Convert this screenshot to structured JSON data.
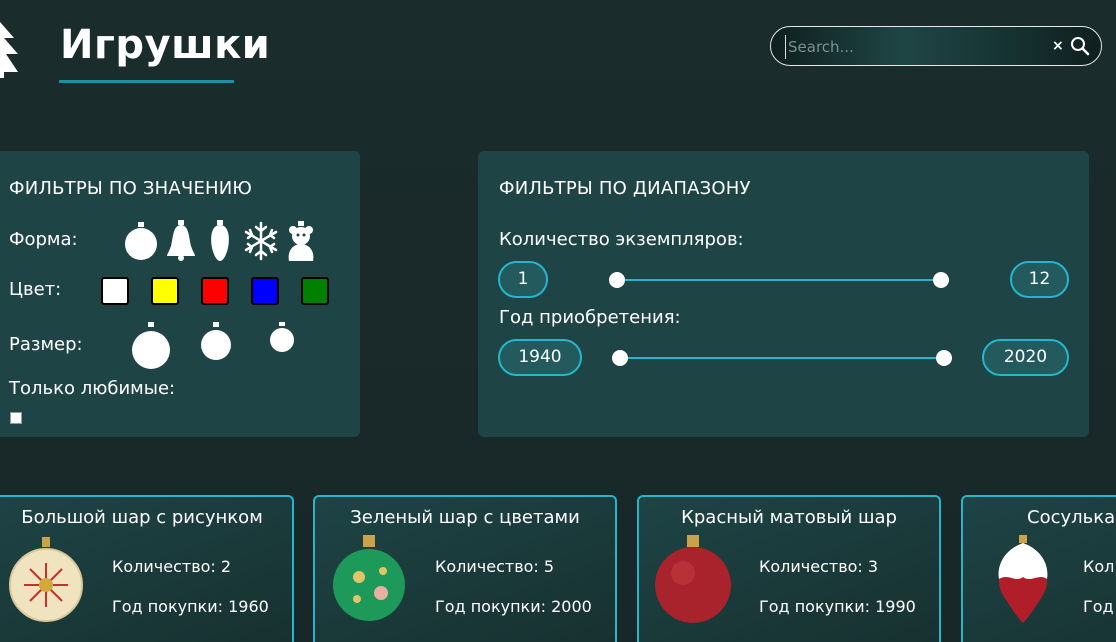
{
  "header": {
    "title": "Игрушки",
    "search_placeholder": "Search...",
    "clear_symbol": "×"
  },
  "filters_value": {
    "heading": "ФИЛЬТРЫ ПО ЗНАЧЕНИЮ",
    "shape_label": "Форма:",
    "shapes": [
      "ball-icon",
      "bell-icon",
      "cone-icon",
      "snowflake-icon",
      "figurine-icon"
    ],
    "color_label": "Цвет:",
    "colors": [
      "#ffffff",
      "#ffff00",
      "#ff0000",
      "#0000ff",
      "#008000"
    ],
    "size_label": "Размер:",
    "sizes": [
      "large",
      "medium",
      "small"
    ],
    "favorite_label": "Только любимые:"
  },
  "filters_range": {
    "heading": "ФИЛЬТРЫ ПО ДИАПАЗОНУ",
    "count_label": "Количество экземпляров:",
    "count_min": "1",
    "count_max": "12",
    "year_label": "Год приобретения:",
    "year_min": "1940",
    "year_max": "2020"
  },
  "cards": [
    {
      "title": "Большой шар с рисунком",
      "count": "Количество: 2",
      "year": "Год покупки: 1960",
      "image": "cream-ball-icon"
    },
    {
      "title": "Зеленый шар с цветами",
      "count": "Количество: 5",
      "year": "Год покупки: 2000",
      "image": "green-ball-icon"
    },
    {
      "title": "Красный матовый шар",
      "count": "Количество: 3",
      "year": "Год покупки: 1990",
      "image": "red-ball-icon"
    },
    {
      "title": "Сосулька",
      "count": "Кол",
      "year": "Год",
      "image": "icicle-icon"
    }
  ],
  "colors": {
    "accent": "#26b6cc",
    "panel": "#1e4446",
    "background": "#1a2a2a"
  }
}
